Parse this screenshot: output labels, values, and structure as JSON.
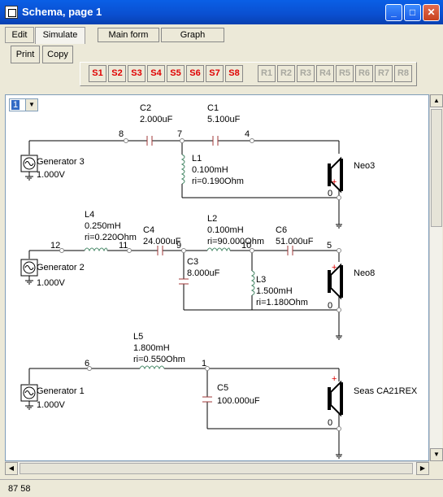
{
  "window": {
    "title": "Schema, page 1"
  },
  "tabs": [
    {
      "label": "Edit"
    },
    {
      "label": "Simulate"
    }
  ],
  "topbuttons": [
    {
      "label": "Main form"
    },
    {
      "label": "Graph"
    }
  ],
  "toolbar": {
    "print": "Print",
    "copy": "Copy"
  },
  "slots_s": [
    "S1",
    "S2",
    "S3",
    "S4",
    "S5",
    "S6",
    "S7",
    "S8"
  ],
  "slots_r": [
    "R1",
    "R2",
    "R3",
    "R4",
    "R5",
    "R6",
    "R7",
    "R8"
  ],
  "page_select": {
    "value": "1"
  },
  "status": {
    "coords": "87  58"
  },
  "schematic": {
    "nodes": [
      "8",
      "7",
      "4",
      "12",
      "11",
      "9",
      "10",
      "5",
      "6",
      "1",
      "0",
      "0",
      "0"
    ],
    "components": {
      "C2": {
        "name": "C2",
        "value": "2.000uF"
      },
      "C1": {
        "name": "C1",
        "value": "5.100uF"
      },
      "L1": {
        "name": "L1",
        "value": "0.100mH",
        "ri": "ri=0.190Ohm"
      },
      "G3": {
        "name": "Generator 3",
        "value": "1.000V"
      },
      "SP1": {
        "name": "Neo3"
      },
      "L4": {
        "name": "L4",
        "value": "0.250mH",
        "ri": "ri=0.220Ohm"
      },
      "C4": {
        "name": "C4",
        "value": "24.000uF"
      },
      "L2": {
        "name": "L2",
        "value": "0.100mH",
        "ri": "ri=90.000Ohm"
      },
      "C6": {
        "name": "C6",
        "value": "51.000uF"
      },
      "C3": {
        "name": "C3",
        "value": "8.000uF"
      },
      "L3": {
        "name": "L3",
        "value": "1.500mH",
        "ri": "ri=1.180Ohm"
      },
      "G2": {
        "name": "Generator 2",
        "value": "1.000V"
      },
      "SP2": {
        "name": "Neo8"
      },
      "L5": {
        "name": "L5",
        "value": "1.800mH",
        "ri": "ri=0.550Ohm"
      },
      "C5": {
        "name": "C5",
        "value": "100.000uF"
      },
      "G1": {
        "name": "Generator 1",
        "value": "1.000V"
      },
      "SP3": {
        "name": "Seas CA21REX"
      }
    }
  }
}
